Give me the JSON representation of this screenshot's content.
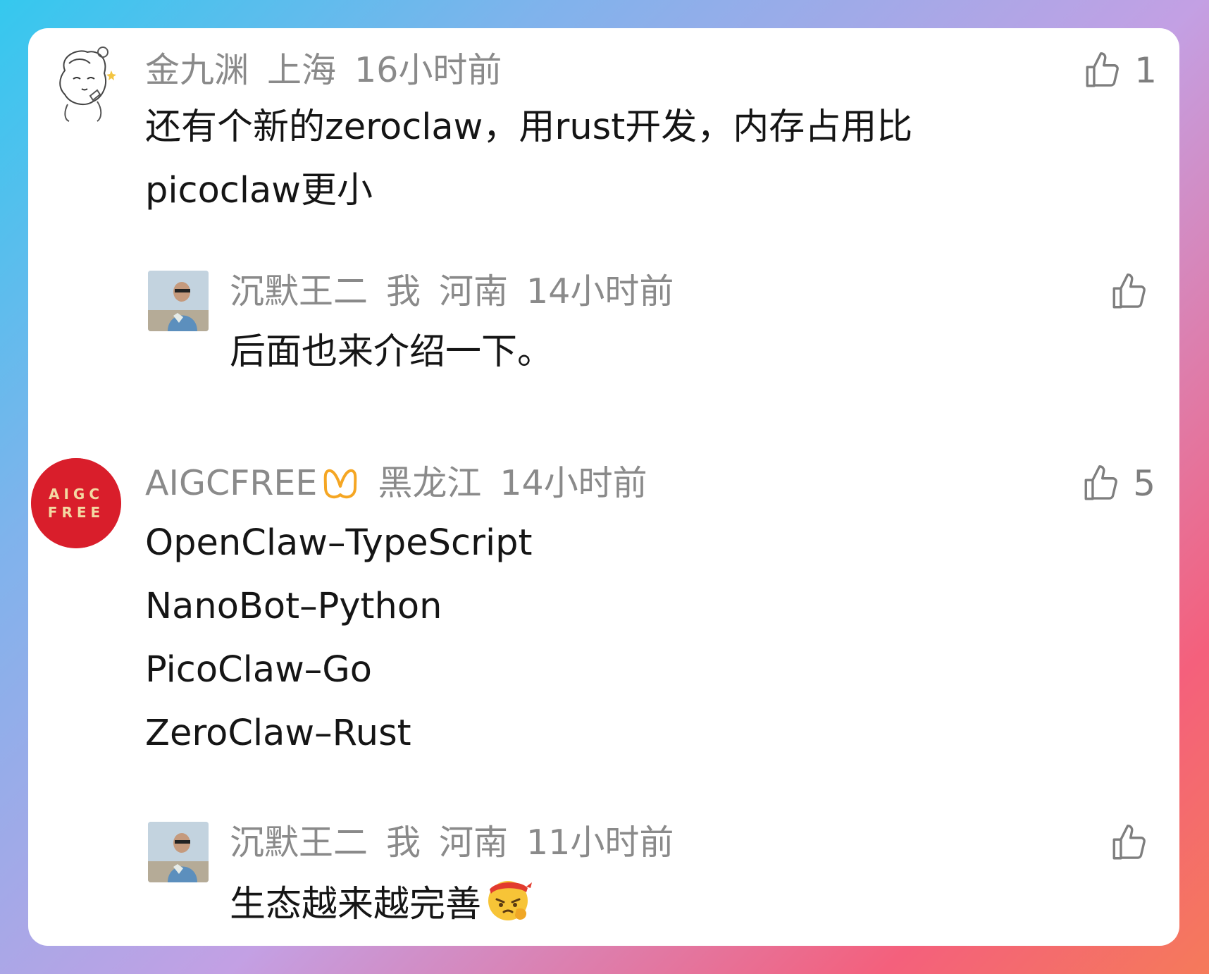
{
  "comments": [
    {
      "user": "金九渊",
      "location": "上海",
      "time": "16小时前",
      "text_lines": [
        "还有个新的zeroclaw，用rust开发，内存占用比",
        "picoclaw更小"
      ],
      "likes": "1",
      "reply": {
        "user": "沉默王二",
        "me_tag": "我",
        "location": "河南",
        "time": "14小时前",
        "text": "后面也来介绍一下。"
      }
    },
    {
      "user": "AIGCFREE",
      "avatar_text": [
        "AIGC",
        "FREE"
      ],
      "location": "黑龙江",
      "time": "14小时前",
      "text_lines": [
        "OpenClaw–TypeScript",
        "NanoBot–Python",
        "PicoClaw–Go",
        "ZeroClaw–Rust"
      ],
      "likes": "5",
      "reply": {
        "user": "沉默王二",
        "me_tag": "我",
        "location": "河南",
        "time": "11小时前",
        "text": "生态越来越完善"
      }
    }
  ],
  "colors": {
    "meta": "#8a8a8a",
    "text": "#151515",
    "badge": "#f5a623",
    "avatar_red": "#d91e2b"
  },
  "icons": {
    "like": "thumbs-up-icon",
    "badge": "butterfly-badge-icon",
    "emoji": "determined-face-emoji"
  }
}
